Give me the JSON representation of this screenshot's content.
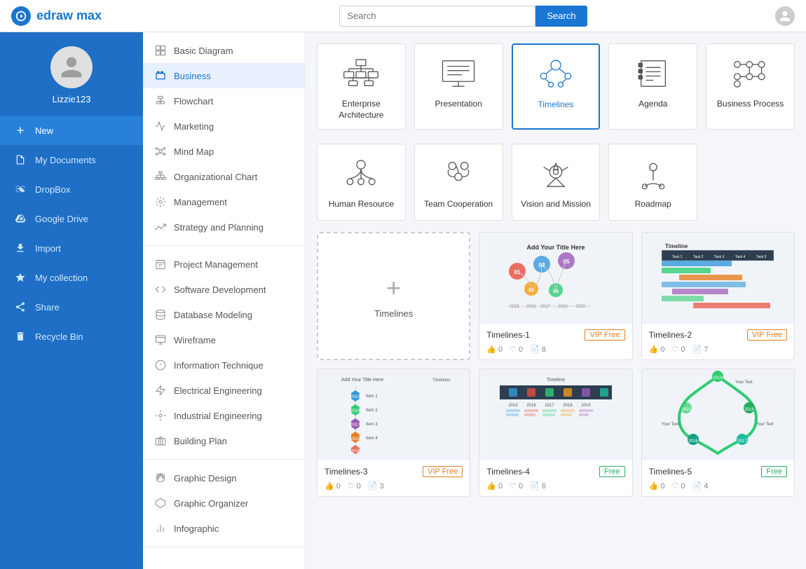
{
  "app": {
    "name": "edraw max",
    "logo_letter": "D"
  },
  "search": {
    "placeholder": "Search",
    "button_label": "Search"
  },
  "sidebar": {
    "username": "Lizzie123",
    "nav_items": [
      {
        "id": "new",
        "label": "New",
        "icon": "plus",
        "active": true
      },
      {
        "id": "my-documents",
        "label": "My Documents",
        "icon": "file",
        "active": false
      },
      {
        "id": "dropbox",
        "label": "DropBox",
        "icon": "box",
        "active": false
      },
      {
        "id": "google-drive",
        "label": "Google Drive",
        "icon": "drive",
        "active": false
      },
      {
        "id": "import",
        "label": "Import",
        "icon": "import",
        "active": false
      },
      {
        "id": "my-collection",
        "label": "My collection",
        "icon": "star",
        "active": false
      },
      {
        "id": "share",
        "label": "Share",
        "icon": "share",
        "active": false
      },
      {
        "id": "recycle-bin",
        "label": "Recycle Bin",
        "icon": "trash",
        "active": false
      }
    ]
  },
  "category_menu": {
    "sections": [
      {
        "items": [
          {
            "id": "basic-diagram",
            "label": "Basic Diagram",
            "icon": "⬜",
            "active": false
          },
          {
            "id": "business",
            "label": "Business",
            "icon": "💼",
            "active": true
          },
          {
            "id": "flowchart",
            "label": "Flowchart",
            "icon": "⬡",
            "active": false
          },
          {
            "id": "marketing",
            "label": "Marketing",
            "icon": "📊",
            "active": false
          },
          {
            "id": "mind-map",
            "label": "Mind Map",
            "icon": "🔷",
            "active": false
          },
          {
            "id": "organizational-chart",
            "label": "Organizational Chart",
            "icon": "🗂",
            "active": false
          },
          {
            "id": "management",
            "label": "Management",
            "icon": "⚙",
            "active": false
          },
          {
            "id": "strategy-planning",
            "label": "Strategy and Planning",
            "icon": "📈",
            "active": false
          }
        ]
      },
      {
        "items": [
          {
            "id": "project-management",
            "label": "Project Management",
            "icon": "📋",
            "active": false
          },
          {
            "id": "software-development",
            "label": "Software Development",
            "icon": "🖥",
            "active": false
          },
          {
            "id": "database-modeling",
            "label": "Database Modeling",
            "icon": "🗄",
            "active": false
          },
          {
            "id": "wireframe",
            "label": "Wireframe",
            "icon": "🖱",
            "active": false
          },
          {
            "id": "information-technique",
            "label": "Information Technique",
            "icon": "ℹ",
            "active": false
          },
          {
            "id": "electrical-engineering",
            "label": "Electrical Engineering",
            "icon": "⚡",
            "active": false
          },
          {
            "id": "industrial-engineering",
            "label": "Industrial Engineering",
            "icon": "🔧",
            "active": false
          },
          {
            "id": "building-plan",
            "label": "Building Plan",
            "icon": "🏗",
            "active": false
          }
        ]
      },
      {
        "items": [
          {
            "id": "graphic-design",
            "label": "Graphic Design",
            "icon": "🎨",
            "active": false
          },
          {
            "id": "graphic-organizer",
            "label": "Graphic Organizer",
            "icon": "✦",
            "active": false
          },
          {
            "id": "infographic",
            "label": "Infographic",
            "icon": "📉",
            "active": false
          }
        ]
      }
    ]
  },
  "templates": {
    "items": [
      {
        "id": "enterprise-architecture",
        "label": "Enterprise Architecture",
        "selected": false
      },
      {
        "id": "presentation",
        "label": "Presentation",
        "selected": false
      },
      {
        "id": "timelines",
        "label": "Timelines",
        "selected": true
      },
      {
        "id": "agenda",
        "label": "Agenda",
        "selected": false
      },
      {
        "id": "business-process",
        "label": "Business Process",
        "selected": false
      },
      {
        "id": "human-resource",
        "label": "Human Resource",
        "selected": false
      },
      {
        "id": "team-cooperation",
        "label": "Team Cooperation",
        "selected": false
      },
      {
        "id": "vision-and-mission",
        "label": "Vision and Mission",
        "selected": false
      },
      {
        "id": "roadmap",
        "label": "Roadmap",
        "selected": false
      }
    ]
  },
  "results": {
    "add_new_label": "Timelines",
    "items": [
      {
        "id": "timelines-1",
        "title": "Timelines-1",
        "badge": "VIP Free",
        "badge_type": "vip",
        "likes": "0",
        "hearts": "0",
        "copies": "8"
      },
      {
        "id": "timelines-2",
        "title": "Timelines-2",
        "badge": "VIP Free",
        "badge_type": "vip",
        "likes": "0",
        "hearts": "0",
        "copies": "7"
      },
      {
        "id": "timelines-3",
        "title": "Timelines-3",
        "badge": "VIP Free",
        "badge_type": "vip",
        "likes": "0",
        "hearts": "0",
        "copies": "3"
      },
      {
        "id": "timelines-4",
        "title": "Timelines-4",
        "badge": "Free",
        "badge_type": "free",
        "likes": "0",
        "hearts": "0",
        "copies": "6"
      },
      {
        "id": "timelines-5",
        "title": "Timelines-5",
        "badge": "Free",
        "badge_type": "free",
        "likes": "0",
        "hearts": "0",
        "copies": "4"
      }
    ]
  }
}
